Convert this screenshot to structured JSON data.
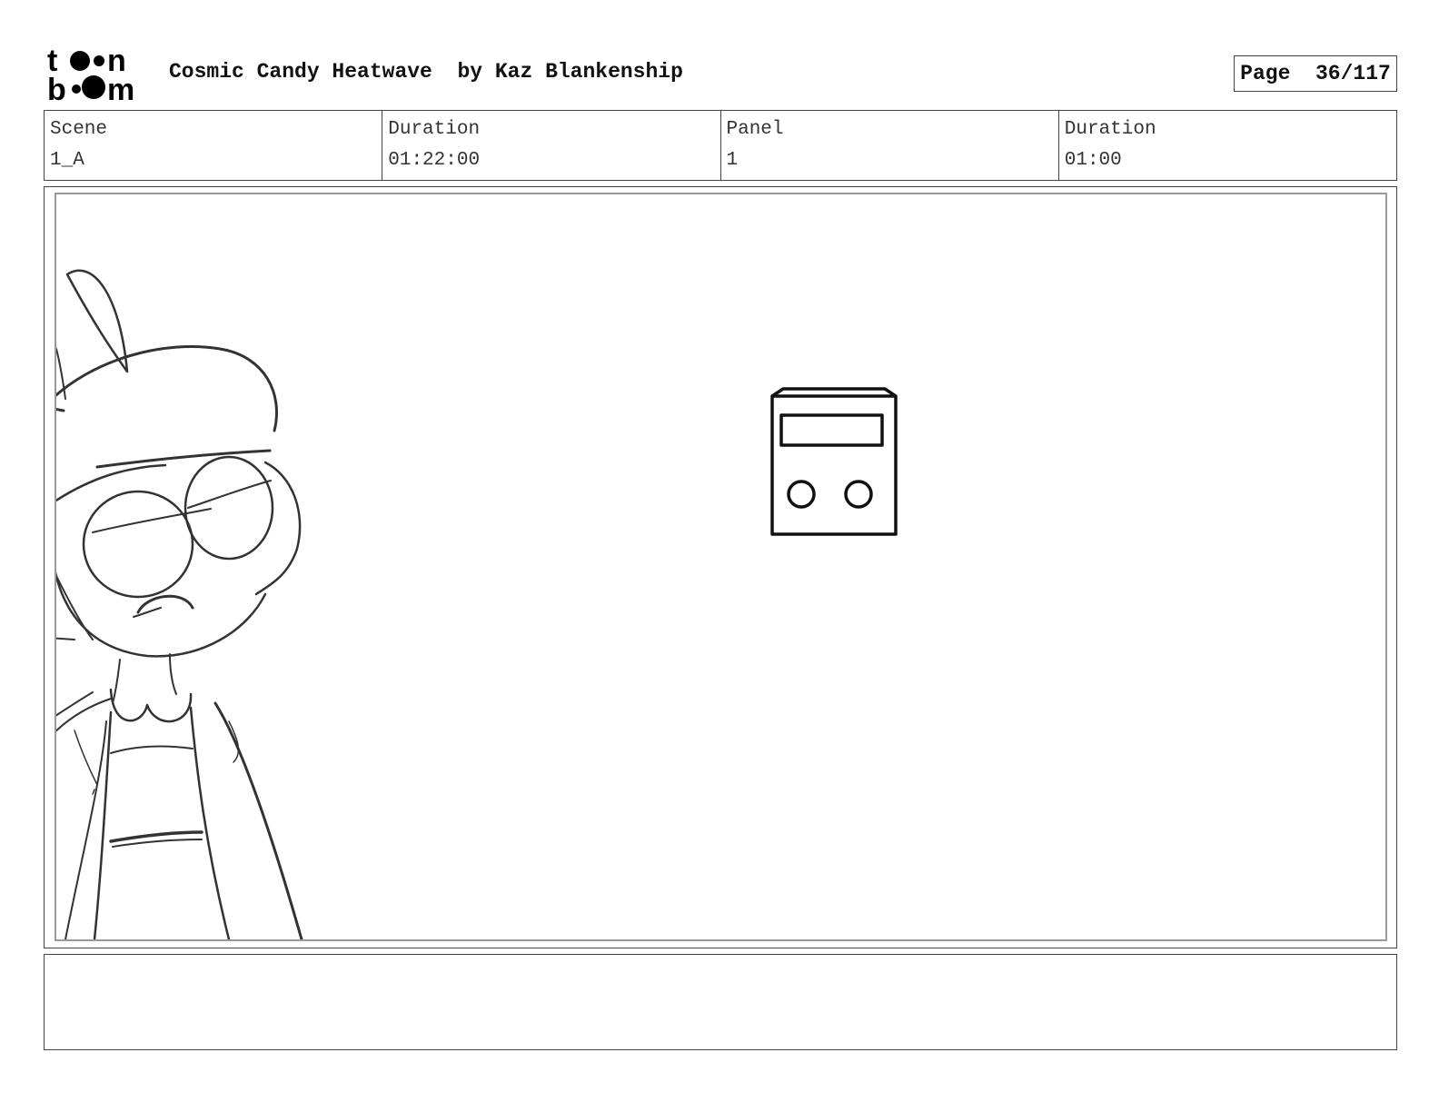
{
  "header": {
    "logo_name": "toon boom",
    "title": "Cosmic Candy Heatwave  by Kaz Blankenship",
    "page_label": "Page  36/117"
  },
  "info": {
    "scene_label": "Scene",
    "scene_value": "1_A",
    "scene_duration_label": "Duration",
    "scene_duration_value": "01:22:00",
    "panel_label": "Panel",
    "panel_value": "1",
    "panel_duration_label": "Duration",
    "panel_duration_value": "01:00"
  },
  "notes": {
    "text": ""
  }
}
